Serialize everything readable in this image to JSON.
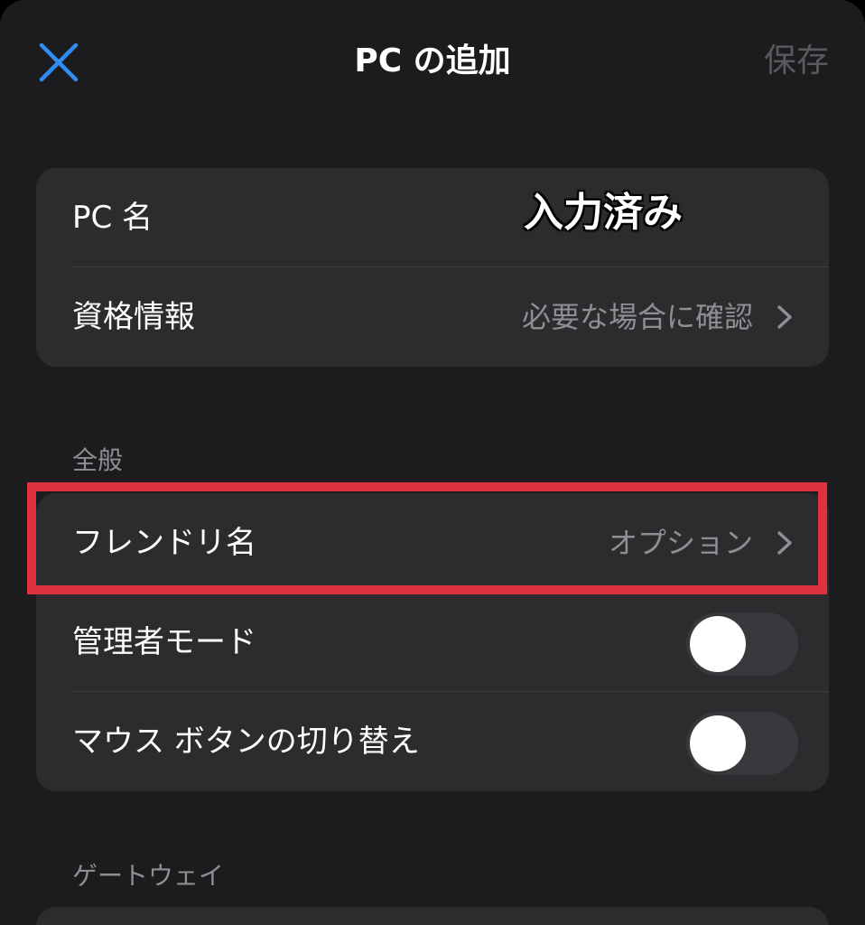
{
  "nav": {
    "title": "PC の追加",
    "save_label": "保存",
    "close_icon": "close-x-icon",
    "accent_color": "#2f8cf0"
  },
  "connection": {
    "pc_name_label": "PC 名",
    "pc_name_annotation": "入力済み",
    "credentials_label": "資格情報",
    "credentials_value": "必要な場合に確認"
  },
  "general": {
    "header": "全般",
    "friendly_name_label": "フレンドリ名",
    "friendly_name_value": "オプション",
    "admin_mode_label": "管理者モード",
    "admin_mode_on": false,
    "swap_mouse_label": "マウス ボタンの切り替え",
    "swap_mouse_on": false,
    "highlight_color": "#e0313f"
  },
  "gateway": {
    "header": "ゲートウェイ"
  }
}
